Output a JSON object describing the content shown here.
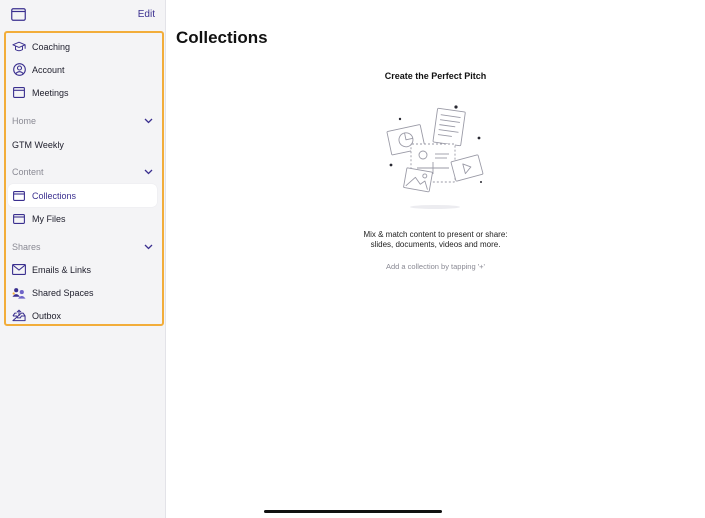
{
  "sidebar": {
    "edit_label": "Edit",
    "items_top": [
      {
        "label": "Coaching",
        "icon": "graduation-cap-icon"
      },
      {
        "label": "Account",
        "icon": "person-circle-icon"
      },
      {
        "label": "Meetings",
        "icon": "calendar-icon"
      }
    ],
    "home": {
      "header": "Home",
      "items": [
        {
          "label": "GTM Weekly"
        }
      ]
    },
    "content": {
      "header": "Content",
      "items": [
        {
          "label": "Collections",
          "icon": "folder-icon",
          "selected": true
        },
        {
          "label": "My Files",
          "icon": "folder-icon"
        }
      ]
    },
    "shares": {
      "header": "Shares",
      "items": [
        {
          "label": "Emails & Links",
          "icon": "envelope-icon"
        },
        {
          "label": "Shared Spaces",
          "icon": "people-icon"
        },
        {
          "label": "Outbox",
          "icon": "outbox-tray-icon"
        }
      ]
    }
  },
  "main": {
    "title": "Collections",
    "empty_state": {
      "heading": "Create the Perfect Pitch",
      "description_line1": "Mix & match content to present or share:",
      "description_line2": "slides, documents, videos and more.",
      "hint": "Add a collection by tapping '+'"
    }
  },
  "colors": {
    "accent": "#3a2f8f",
    "highlight_border": "#f2ad3a",
    "sidebar_bg": "#f4f4f6"
  }
}
